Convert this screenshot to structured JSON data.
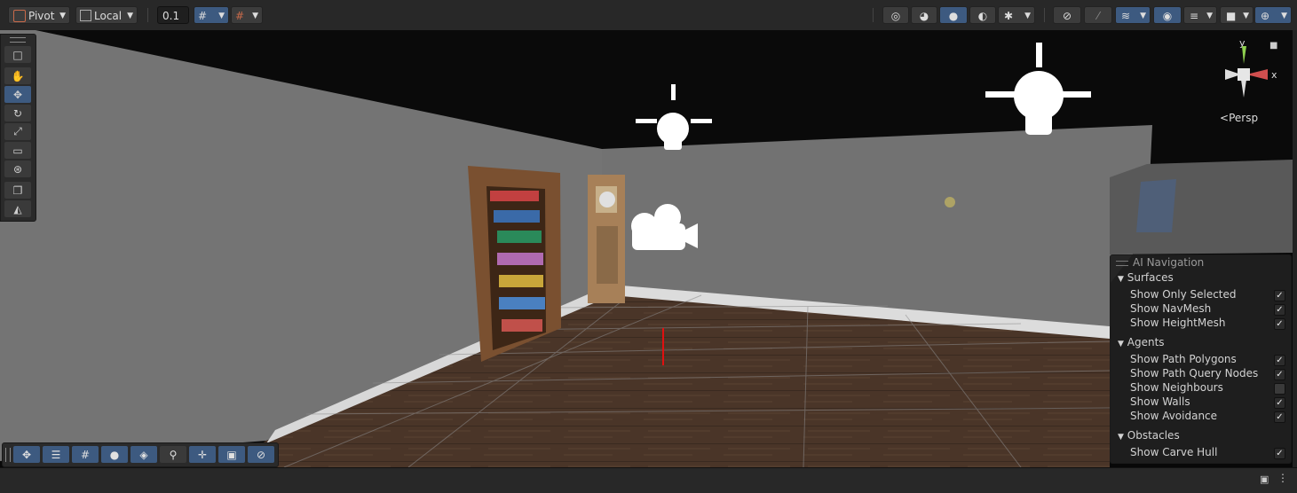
{
  "toolbar": {
    "pivot_label": "Pivot",
    "local_label": "Local",
    "snap_value": "0.1"
  },
  "gizmo": {
    "y_label": "y",
    "x_label": "x",
    "projection_label": "Persp"
  },
  "ai_navigation": {
    "title": "AI Navigation",
    "surfaces": {
      "label": "Surfaces",
      "items": [
        {
          "label": "Show Only Selected",
          "checked": true
        },
        {
          "label": "Show NavMesh",
          "checked": true
        },
        {
          "label": "Show HeightMesh",
          "checked": true
        }
      ]
    },
    "agents": {
      "label": "Agents",
      "items": [
        {
          "label": "Show Path Polygons",
          "checked": true
        },
        {
          "label": "Show Path Query Nodes",
          "checked": true
        },
        {
          "label": "Show Neighbours",
          "checked": false
        },
        {
          "label": "Show Walls",
          "checked": true
        },
        {
          "label": "Show Avoidance",
          "checked": true
        }
      ]
    },
    "obstacles": {
      "label": "Obstacles",
      "items": [
        {
          "label": "Show Carve Hull",
          "checked": true
        }
      ]
    }
  },
  "colors": {
    "accent": "#3d5a80",
    "toolbar_bg": "#282828",
    "wall": "#6f6f6f",
    "floor": "#4a3528",
    "gizmo_y": "#8fd14f",
    "gizmo_x": "#d14f4f"
  }
}
